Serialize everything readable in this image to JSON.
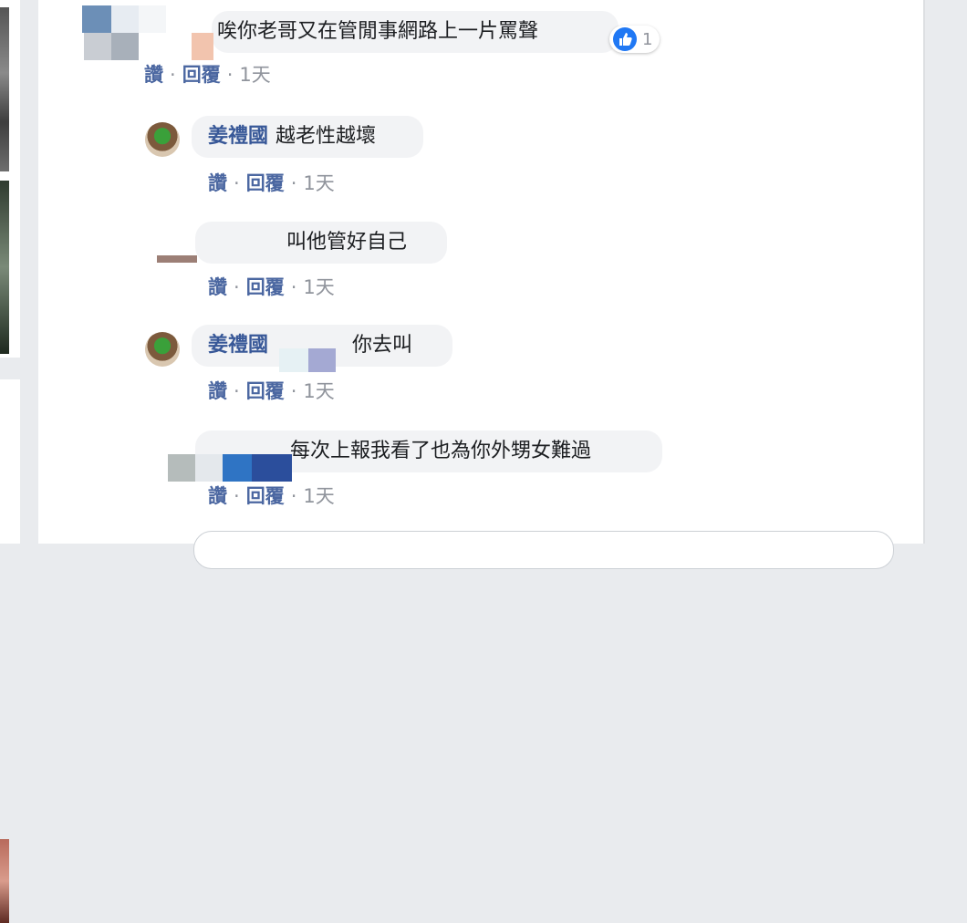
{
  "comments": [
    {
      "author": "",
      "text": "唉你老哥又在管閒事網路上一片罵聲",
      "like_action": "讚",
      "reply_action": "回覆",
      "time": "1天",
      "reaction_count": "1",
      "reaction_icon": "like-icon"
    },
    {
      "author": "姜禮國",
      "text": "越老性越壞",
      "like_action": "讚",
      "reply_action": "回覆",
      "time": "1天"
    },
    {
      "author": "",
      "text": "叫他管好自己",
      "like_action": "讚",
      "reply_action": "回覆",
      "time": "1天"
    },
    {
      "author": "姜禮國",
      "text": "你去叫",
      "like_action": "讚",
      "reply_action": "回覆",
      "time": "1天"
    },
    {
      "author": "",
      "text": "每次上報我看了也為你外甥女難過",
      "like_action": "讚",
      "reply_action": "回覆",
      "time": "1天"
    }
  ],
  "separator": "·",
  "colors": {
    "link": "#385898",
    "bubble": "#f2f3f5",
    "meta": "#90949c",
    "like_blue": "#2078f4"
  }
}
